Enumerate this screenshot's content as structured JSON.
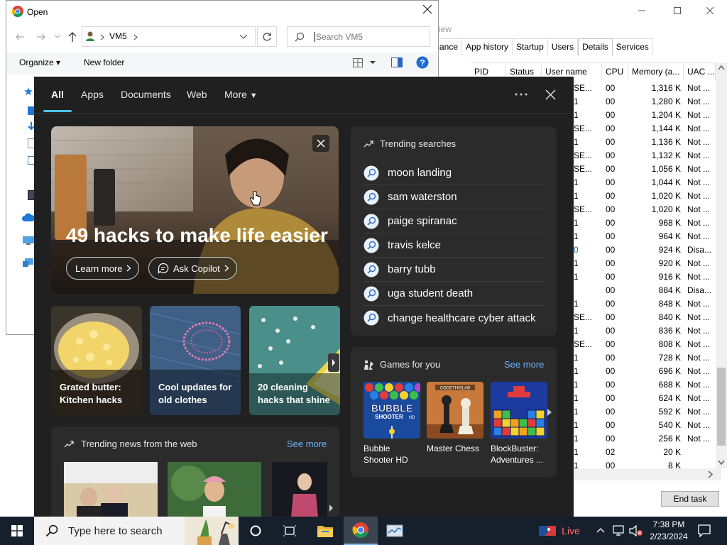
{
  "task_manager": {
    "view_menu": "iew",
    "tabs": [
      "rmance",
      "App history",
      "Startup",
      "Users",
      "Details",
      "Services"
    ],
    "active_tab": "Details",
    "columns": [
      "PID",
      "Status",
      "User name",
      "CPU",
      "Memory (a...",
      "UAC ..."
    ],
    "rows": [
      {
        "user": "SE...",
        "cpu": "00",
        "mem": "1,316 K",
        "uac": "Not ..."
      },
      {
        "user": "1",
        "cpu": "00",
        "mem": "1,280 K",
        "uac": "Not ..."
      },
      {
        "user": "1",
        "cpu": "00",
        "mem": "1,204 K",
        "uac": "Not ..."
      },
      {
        "user": "SE...",
        "cpu": "00",
        "mem": "1,144 K",
        "uac": "Not ..."
      },
      {
        "user": "1",
        "cpu": "00",
        "mem": "1,136 K",
        "uac": "Not ..."
      },
      {
        "user": "SE...",
        "cpu": "00",
        "mem": "1,132 K",
        "uac": "Not ..."
      },
      {
        "user": "SE...",
        "cpu": "00",
        "mem": "1,056 K",
        "uac": "Not ..."
      },
      {
        "user": "1",
        "cpu": "00",
        "mem": "1,044 K",
        "uac": "Not ..."
      },
      {
        "user": "1",
        "cpu": "00",
        "mem": "1,020 K",
        "uac": "Not ..."
      },
      {
        "user": "SE...",
        "cpu": "00",
        "mem": "1,020 K",
        "uac": "Not ..."
      },
      {
        "user": "1",
        "cpu": "00",
        "mem": "968 K",
        "uac": "Not ..."
      },
      {
        "user": "1",
        "cpu": "00",
        "mem": "964 K",
        "uac": "Not ..."
      },
      {
        "user": "0",
        "cpu": "00",
        "mem": "924 K",
        "uac": "Disa..."
      },
      {
        "user": "1",
        "cpu": "00",
        "mem": "920 K",
        "uac": "Not ..."
      },
      {
        "user": "1",
        "cpu": "00",
        "mem": "916 K",
        "uac": "Not ..."
      },
      {
        "user": "",
        "cpu": "00",
        "mem": "884 K",
        "uac": "Disa..."
      },
      {
        "user": "1",
        "cpu": "00",
        "mem": "848 K",
        "uac": "Not ..."
      },
      {
        "user": "SE...",
        "cpu": "00",
        "mem": "840 K",
        "uac": "Not ..."
      },
      {
        "user": "1",
        "cpu": "00",
        "mem": "836 K",
        "uac": "Not ..."
      },
      {
        "user": "SE...",
        "cpu": "00",
        "mem": "808 K",
        "uac": "Not ..."
      },
      {
        "user": "1",
        "cpu": "00",
        "mem": "728 K",
        "uac": "Not ..."
      },
      {
        "user": "1",
        "cpu": "00",
        "mem": "696 K",
        "uac": "Not ..."
      },
      {
        "user": "1",
        "cpu": "00",
        "mem": "688 K",
        "uac": "Not ..."
      },
      {
        "user": "1",
        "cpu": "00",
        "mem": "624 K",
        "uac": "Not ..."
      },
      {
        "user": "1",
        "cpu": "00",
        "mem": "592 K",
        "uac": "Not ..."
      },
      {
        "user": "1",
        "cpu": "00",
        "mem": "540 K",
        "uac": "Not ..."
      },
      {
        "user": "1",
        "cpu": "00",
        "mem": "256 K",
        "uac": "Not ..."
      },
      {
        "user": "1",
        "cpu": "02",
        "mem": "20 K",
        "uac": ""
      },
      {
        "user": "1",
        "cpu": "00",
        "mem": "8 K",
        "uac": ""
      }
    ],
    "end_task": "End task"
  },
  "open_dialog": {
    "title": "Open",
    "address_path": "VM5",
    "search_placeholder": "Search VM5",
    "organize": "Organize",
    "new_folder": "New folder"
  },
  "flyout": {
    "tabs": [
      "All",
      "Apps",
      "Documents",
      "Web",
      "More"
    ],
    "active_tab": "All",
    "hero": {
      "title": "49 hacks to make life easier",
      "learn_more": "Learn more",
      "ask_copilot": "Ask Copilot"
    },
    "cards": [
      {
        "line1": "Grated butter:",
        "line2": "Kitchen hacks"
      },
      {
        "line1": "Cool updates for",
        "line2": "old clothes"
      },
      {
        "line1": "20 cleaning",
        "line2": "hacks that shine"
      }
    ],
    "trending_title": "Trending searches",
    "trending": [
      "moon landing",
      "sam waterston",
      "paige spiranac",
      "travis kelce",
      "barry tubb",
      "uga student death",
      "change healthcare cyber attack"
    ],
    "games_title": "Games for you",
    "games_see_more": "See more",
    "games": [
      {
        "line1": "Bubble",
        "line2": "Shooter HD"
      },
      {
        "line1": "Master Chess",
        "line2": ""
      },
      {
        "line1": "BlockBuster:",
        "line2": "Adventures ..."
      }
    ],
    "game_art": {
      "bubble_top": "BUBBLE",
      "bubble_mid": "SHOOTER",
      "bubble_hd": "HD",
      "chess_brand": "CODETHISLAB"
    },
    "news_title": "Trending news from the web",
    "news_see_more": "See more"
  },
  "taskbar": {
    "search_placeholder": "Type here to search",
    "live": "Live",
    "time": "7:38 PM",
    "date": "2/23/2024"
  },
  "colors": {
    "flyout_bg": "#202020",
    "panel_bg": "#2b2b2b",
    "accent": "#4cc2ff",
    "see_more": "#6cb4ff",
    "taskbar": "#16202c"
  }
}
